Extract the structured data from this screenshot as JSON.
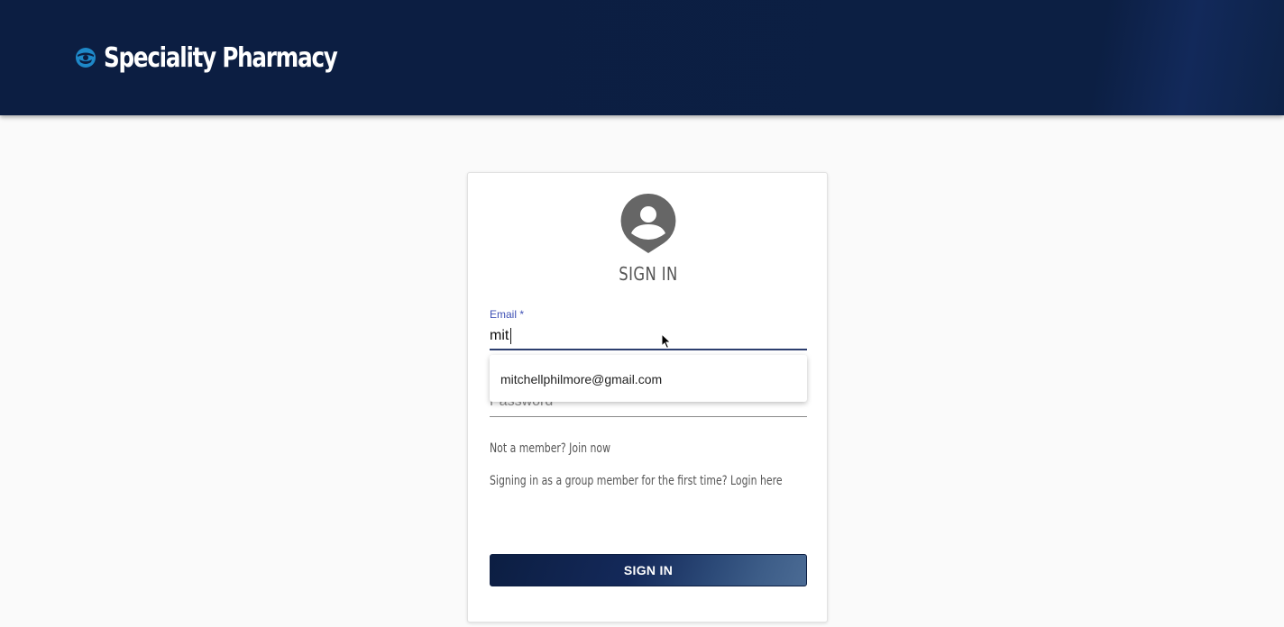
{
  "header": {
    "brand_name": "Speciality Pharmacy",
    "logo_icon": "globe-shield-icon",
    "background_color": "#0c1e42"
  },
  "signin": {
    "avatar_icon": "account-circle-icon",
    "title": "SIGN IN",
    "email_label": "Email *",
    "email_value": "mit",
    "autocomplete_suggestion": "mitchellphilmore@gmail.com",
    "password_label": "Password *",
    "join_text": "Not a member? Join now",
    "group_text": "Signing in as a group member for the first time? Login here",
    "button_label": "SIGN IN",
    "accent_color": "#3f51b5"
  }
}
